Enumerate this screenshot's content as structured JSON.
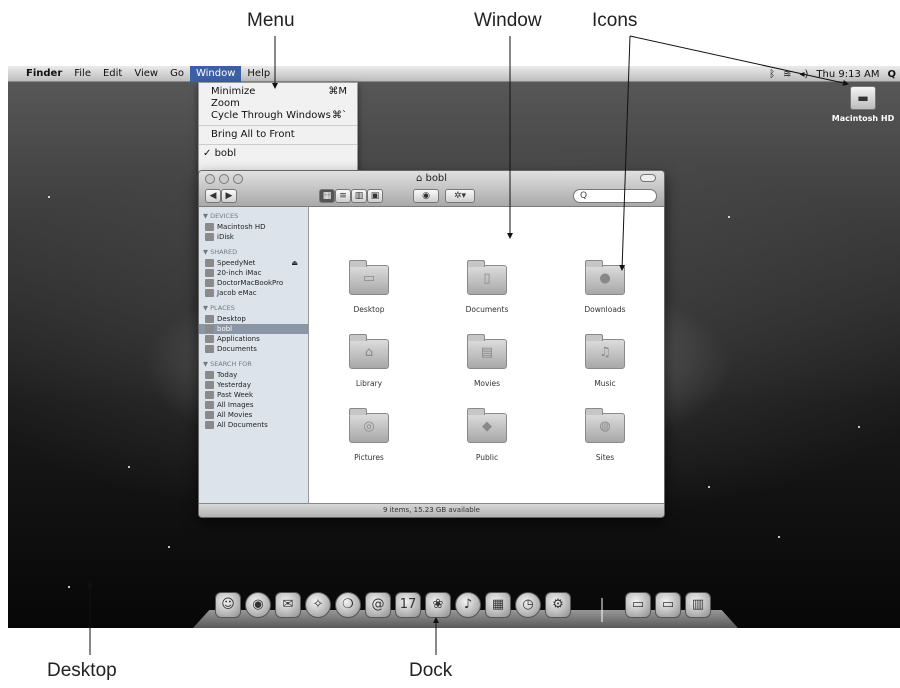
{
  "callouts": {
    "menu": "Menu",
    "window": "Window",
    "icons": "Icons",
    "desktop": "Desktop",
    "dock": "Dock"
  },
  "menubar": {
    "apple": "",
    "items": [
      "Finder",
      "File",
      "Edit",
      "View",
      "Go",
      "Window",
      "Help"
    ],
    "active": "Window",
    "clock": "Thu 9:13 AM",
    "icons": [
      "bluetooth-icon",
      "wifi-icon",
      "volume-icon",
      "spotlight-icon"
    ]
  },
  "window_menu": {
    "items": [
      {
        "label": "Minimize",
        "shortcut": "⌘M"
      },
      {
        "label": "Zoom",
        "shortcut": ""
      },
      {
        "label": "Cycle Through Windows",
        "shortcut": "⌘`"
      },
      {
        "label": "Bring All to Front",
        "shortcut": ""
      },
      {
        "label": "bobl",
        "shortcut": ""
      }
    ],
    "checked": "✓"
  },
  "desktop": {
    "drive_label": "Macintosh HD"
  },
  "finder": {
    "title": "bobl",
    "search_placeholder": "Q",
    "sidebar": {
      "devices": {
        "header": "▼ DEVICES",
        "items": [
          "Macintosh HD",
          "iDisk"
        ]
      },
      "shared": {
        "header": "▼ SHARED",
        "items": [
          "SpeedyNet",
          "20-inch iMac",
          "DoctorMacBookPro",
          "Jacob eMac"
        ]
      },
      "places": {
        "header": "▼ PLACES",
        "items": [
          "Desktop",
          "bobl",
          "Applications",
          "Documents"
        ],
        "selected": "bobl"
      },
      "search": {
        "header": "▼ SEARCH FOR",
        "items": [
          "Today",
          "Yesterday",
          "Past Week",
          "All Images",
          "All Movies",
          "All Documents"
        ]
      }
    },
    "items": [
      "Desktop",
      "Documents",
      "Downloads",
      "Library",
      "Movies",
      "Music",
      "Pictures",
      "Public",
      "Sites"
    ],
    "status": "9 items, 15.23 GB available"
  },
  "dock": {
    "items": [
      "finder-icon",
      "dashboard-icon",
      "mail-icon",
      "safari-icon",
      "ichat-icon",
      "address-book-icon",
      "ical-icon",
      "iphoto-icon",
      "itunes-icon",
      "spaces-icon",
      "time-machine-icon",
      "system-preferences-icon",
      "documents-stack-icon",
      "downloads-stack-icon",
      "trash-icon"
    ]
  }
}
